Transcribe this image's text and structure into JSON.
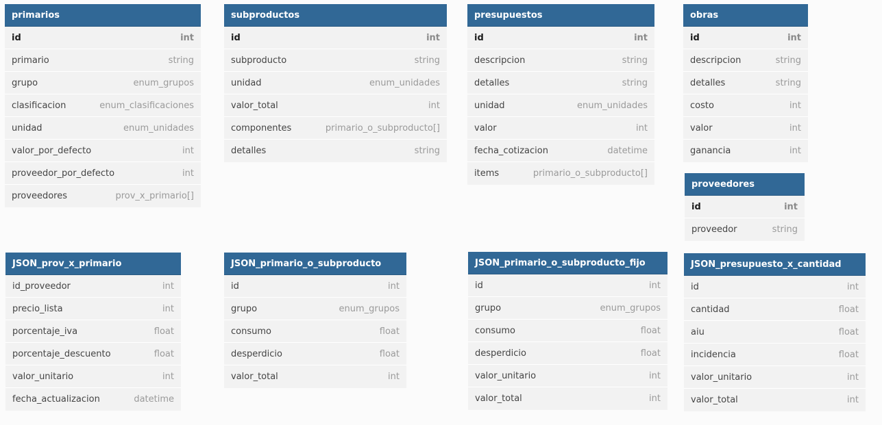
{
  "tables": [
    {
      "name": "primarios",
      "columns": [
        {
          "name": "id",
          "type": "int",
          "pk": true
        },
        {
          "name": "primario",
          "type": "string"
        },
        {
          "name": "grupo",
          "type": "enum_grupos"
        },
        {
          "name": "clasificacion",
          "type": "enum_clasificaciones"
        },
        {
          "name": "unidad",
          "type": "enum_unidades"
        },
        {
          "name": "valor_por_defecto",
          "type": "int"
        },
        {
          "name": "proveedor_por_defecto",
          "type": "int"
        },
        {
          "name": "proveedores",
          "type": "prov_x_primario[]"
        }
      ]
    },
    {
      "name": "subproductos",
      "columns": [
        {
          "name": "id",
          "type": "int",
          "pk": true
        },
        {
          "name": "subproducto",
          "type": "string"
        },
        {
          "name": "unidad",
          "type": "enum_unidades"
        },
        {
          "name": "valor_total",
          "type": "int"
        },
        {
          "name": "componentes",
          "type": "primario_o_subproducto[]"
        },
        {
          "name": "detalles",
          "type": "string"
        }
      ]
    },
    {
      "name": "presupuestos",
      "columns": [
        {
          "name": "id",
          "type": "int",
          "pk": true
        },
        {
          "name": "descripcion",
          "type": "string"
        },
        {
          "name": "detalles",
          "type": "string"
        },
        {
          "name": "unidad",
          "type": "enum_unidades"
        },
        {
          "name": "valor",
          "type": "int"
        },
        {
          "name": "fecha_cotizacion",
          "type": "datetime"
        },
        {
          "name": "items",
          "type": "primario_o_subproducto[]"
        }
      ]
    },
    {
      "name": "obras",
      "columns": [
        {
          "name": "id",
          "type": "int",
          "pk": true
        },
        {
          "name": "descripcion",
          "type": "string"
        },
        {
          "name": "detalles",
          "type": "string"
        },
        {
          "name": "costo",
          "type": "int"
        },
        {
          "name": "valor",
          "type": "int"
        },
        {
          "name": "ganancia",
          "type": "int"
        }
      ]
    },
    {
      "name": "proveedores",
      "columns": [
        {
          "name": "id",
          "type": "int",
          "pk": true
        },
        {
          "name": "proveedor",
          "type": "string"
        }
      ]
    },
    {
      "name": "JSON_prov_x_primario",
      "columns": [
        {
          "name": "id_proveedor",
          "type": "int"
        },
        {
          "name": "precio_lista",
          "type": "int"
        },
        {
          "name": "porcentaje_iva",
          "type": "float"
        },
        {
          "name": "porcentaje_descuento",
          "type": "float"
        },
        {
          "name": "valor_unitario",
          "type": "int"
        },
        {
          "name": "fecha_actualizacion",
          "type": "datetime"
        }
      ]
    },
    {
      "name": "JSON_primario_o_subproducto",
      "columns": [
        {
          "name": "id",
          "type": "int"
        },
        {
          "name": "grupo",
          "type": "enum_grupos"
        },
        {
          "name": "consumo",
          "type": "float"
        },
        {
          "name": "desperdicio",
          "type": "float"
        },
        {
          "name": "valor_total",
          "type": "int"
        }
      ]
    },
    {
      "name": "JSON_primario_o_subproducto_fijo",
      "columns": [
        {
          "name": "id",
          "type": "int"
        },
        {
          "name": "grupo",
          "type": "enum_grupos"
        },
        {
          "name": "consumo",
          "type": "float"
        },
        {
          "name": "desperdicio",
          "type": "float"
        },
        {
          "name": "valor_unitario",
          "type": "int"
        },
        {
          "name": "valor_total",
          "type": "int"
        }
      ]
    },
    {
      "name": "JSON_presupuesto_x_cantidad",
      "columns": [
        {
          "name": "id",
          "type": "int"
        },
        {
          "name": "cantidad",
          "type": "float"
        },
        {
          "name": "aiu",
          "type": "float"
        },
        {
          "name": "incidencia",
          "type": "float"
        },
        {
          "name": "valor_unitario",
          "type": "int"
        },
        {
          "name": "valor_total",
          "type": "int"
        }
      ]
    }
  ]
}
